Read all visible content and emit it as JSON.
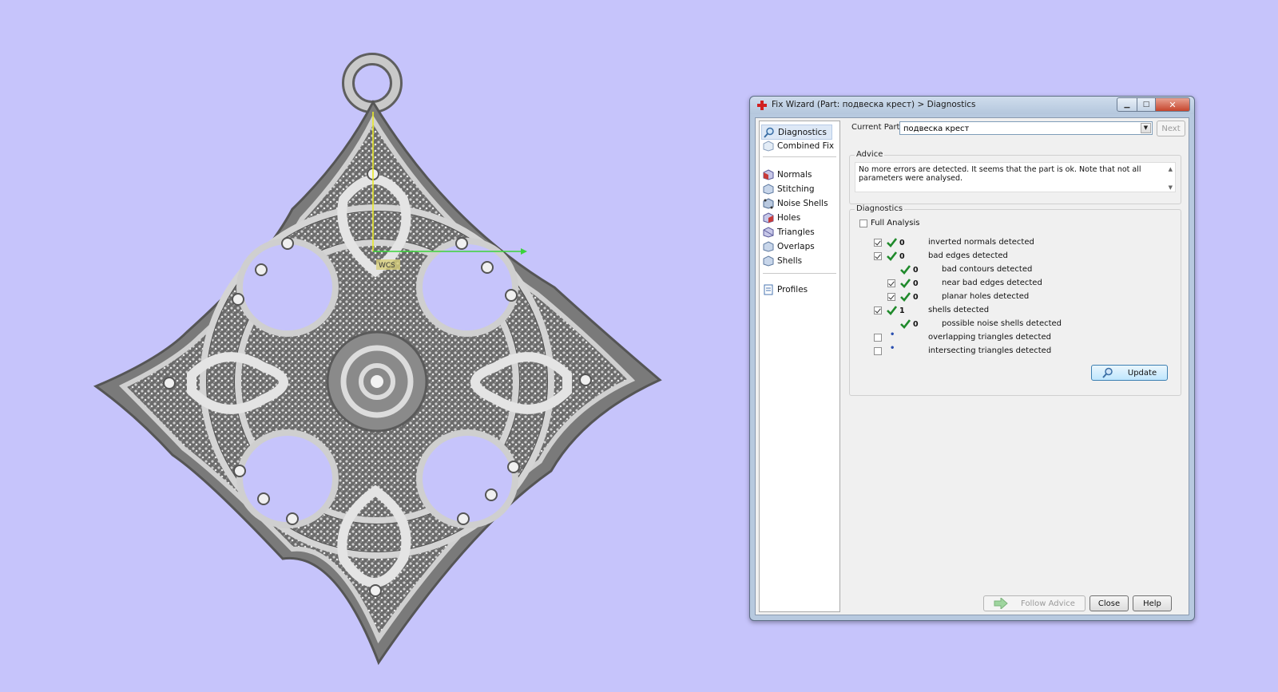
{
  "window": {
    "title": "Fix Wizard (Part: подвеска крест) > Diagnostics"
  },
  "nav": {
    "items": [
      {
        "label": "Diagnostics",
        "icon": "magnifier-icon"
      },
      {
        "label": "Combined Fix",
        "icon": "cube-icon"
      },
      {
        "label": "Normals",
        "icon": "cube-icon"
      },
      {
        "label": "Stitching",
        "icon": "cube-icon"
      },
      {
        "label": "Noise Shells",
        "icon": "cube-icon"
      },
      {
        "label": "Holes",
        "icon": "cube-icon"
      },
      {
        "label": "Triangles",
        "icon": "cube-icon"
      },
      {
        "label": "Overlaps",
        "icon": "cube-icon"
      },
      {
        "label": "Shells",
        "icon": "cube-icon"
      },
      {
        "label": "Profiles",
        "icon": "document-icon"
      }
    ],
    "selected": "Diagnostics"
  },
  "current_part": {
    "label": "Current Part:",
    "value": "подвеска крест"
  },
  "next_button": "Next",
  "advice": {
    "title": "Advice",
    "text": "No more errors are detected. It seems that the part is ok. Note that not all parameters were analysed."
  },
  "diagnostics": {
    "title": "Diagnostics",
    "full_analysis": {
      "label": "Full Analysis",
      "checked": false
    },
    "rows": [
      {
        "label": "inverted normals detected",
        "count": "0",
        "checked": true,
        "status": "ok"
      },
      {
        "label": "bad edges detected",
        "count": "0",
        "checked": true,
        "status": "ok"
      },
      {
        "label": "bad contours detected",
        "count": "0",
        "status": "ok"
      },
      {
        "label": "near bad edges detected",
        "count": "0",
        "checked": true,
        "status": "ok"
      },
      {
        "label": "planar holes detected",
        "count": "0",
        "checked": true,
        "status": "ok"
      },
      {
        "label": "shells detected",
        "count": "1",
        "checked": true,
        "status": "ok"
      },
      {
        "label": "possible noise shells detected",
        "count": "0",
        "status": "ok"
      },
      {
        "label": "overlapping triangles detected",
        "count": "",
        "checked": false,
        "status": "pending"
      },
      {
        "label": "intersecting triangles detected",
        "count": "",
        "checked": false,
        "status": "pending"
      }
    ],
    "update_button": "Update"
  },
  "footer": {
    "follow_advice": "Follow Advice",
    "close": "Close",
    "help": "Help"
  },
  "viewport": {
    "axis_label": "WCS"
  },
  "colors": {
    "background": "#c6c4fb",
    "ok_check": "#1f8a2b",
    "axis_y": "#e8e82a",
    "axis_x": "#3bd33b"
  }
}
